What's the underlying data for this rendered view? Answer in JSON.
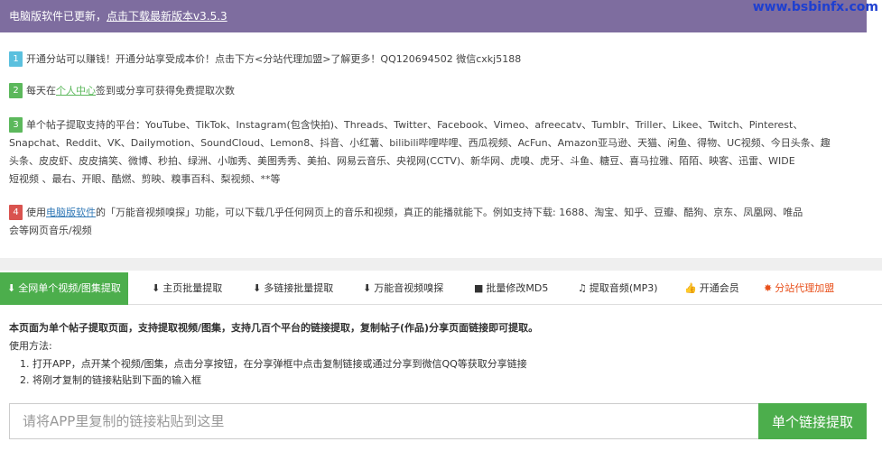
{
  "banner": {
    "text": "电脑版软件已更新，",
    "link": "点击下载最新版本v3.5.3"
  },
  "watermark": "www.bsbinfx.com",
  "notes": [
    {
      "number": "1",
      "text": "开通分站可以赚钱！开通分站享受成本价！点击下方<分站代理加盟>了解更多！QQ120694502 微信cxkj5188"
    },
    {
      "number": "2",
      "before": "每天在",
      "link": "个人中心",
      "after": "签到或分享可获得免费提取次数"
    },
    {
      "number": "3",
      "line1": "单个帖子提取支持的平台：YouTube、TikTok、Instagram(包含快拍)、Threads、Twitter、Facebook、Vimeo、afreecatv、Tumblr、Triller、Likee、Twitch、Pinterest、",
      "line2": "Snapchat、Reddit、VK、Dailymotion、SoundCloud、Lemon8、抖音、小红薯、bilibili哔哩哔哩、西瓜视频、AcFun、Amazon亚马逊、天猫、闲鱼、得物、UC视频、今日头条、趣",
      "line3": "头条、皮皮虾、皮皮搞笑、微博、秒拍、绿洲、小咖秀、美图秀秀、美拍、网易云音乐、央视网(CCTV)、新华网、虎嗅、虎牙、斗鱼、糖豆、喜马拉雅、陌陌、映客、迅雷、WIDE",
      "line4": "短视频 、最右、开眼、酷燃、剪映、糗事百科、梨视频、**等"
    },
    {
      "number": "4",
      "before": "使用",
      "link": "电脑版软件",
      "after": "的「万能音视频嗅探」功能，可以下载几乎任何网页上的音乐和视频，真正的能播就能下。例如支持下载: 1688、淘宝、知乎、豆瓣、酷狗、京东、凤凰网、唯品",
      "line2": "会等网页音乐/视频"
    }
  ],
  "tabs": [
    {
      "label": "全网单个视频/图集提取",
      "icon": "download-icon",
      "glyph": "⬇"
    },
    {
      "label": "主页批量提取",
      "icon": "download-icon",
      "glyph": "⬇"
    },
    {
      "label": "多链接批量提取",
      "icon": "download-icon",
      "glyph": "⬇"
    },
    {
      "label": "万能音视频嗅探",
      "icon": "download-icon",
      "glyph": "⬇"
    },
    {
      "label": "批量修改MD5",
      "icon": "video-camera-icon",
      "glyph": "■"
    },
    {
      "label": "提取音频(MP3)",
      "icon": "music-note-icon",
      "glyph": "♫"
    },
    {
      "label": "开通会员",
      "icon": "thumbs-up-icon",
      "glyph": "👍"
    },
    {
      "label": "分站代理加盟",
      "icon": "star-icon",
      "glyph": "✸"
    }
  ],
  "description": {
    "headline": "本页面为单个帖子提取页面，支持提取视频/图集，支持几百个平台的链接提取，复制帖子(作品)分享页面链接即可提取。",
    "usage_label": "使用方法:",
    "step1": "1. 打开APP，点开某个视频/图集，点击分享按钮，在分享弹框中点击复制链接或通过分享到微信QQ等获取分享链接",
    "step2": "2. 将刚才复制的链接粘贴到下面的输入框"
  },
  "search": {
    "placeholder": "请将APP里复制的链接粘贴到这里",
    "value": "",
    "button": "单个链接提取"
  },
  "colors": {
    "banner": "#7e6d9f",
    "accent_green": "#4cae4c",
    "hot_orange": "#e8501b",
    "watermark": "#1e3fd0"
  }
}
